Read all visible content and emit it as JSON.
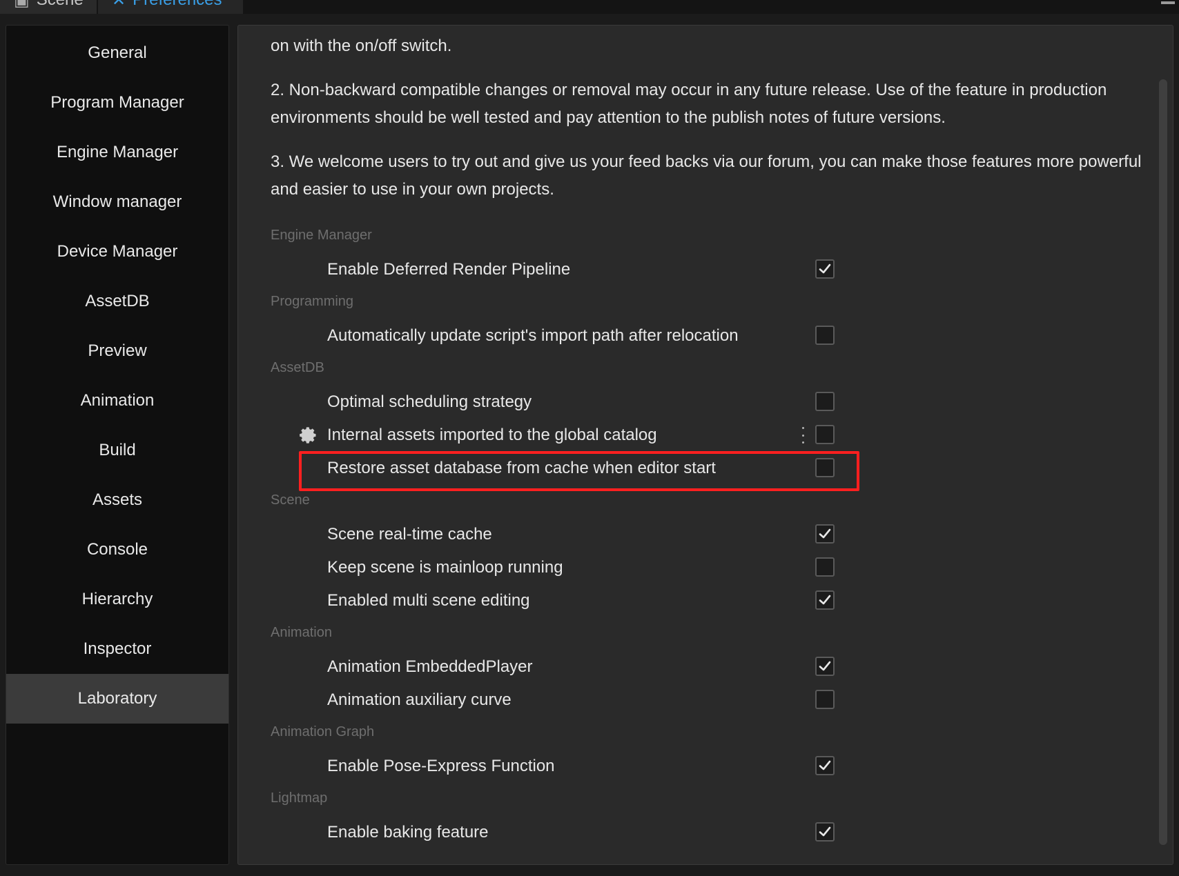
{
  "tabs": {
    "scene": "Scene",
    "preferences": "Preferences"
  },
  "sidebar": {
    "items": [
      {
        "label": "General"
      },
      {
        "label": "Program Manager"
      },
      {
        "label": "Engine Manager"
      },
      {
        "label": "Window manager"
      },
      {
        "label": "Device Manager"
      },
      {
        "label": "AssetDB"
      },
      {
        "label": "Preview"
      },
      {
        "label": "Animation"
      },
      {
        "label": "Build"
      },
      {
        "label": "Assets"
      },
      {
        "label": "Console"
      },
      {
        "label": "Hierarchy"
      },
      {
        "label": "Inspector"
      },
      {
        "label": "Laboratory"
      }
    ],
    "active": "Laboratory"
  },
  "notes": {
    "p1": "on with the on/off switch.",
    "p2": "2. Non-backward compatible changes or removal may occur in any future release. Use of the feature in production environments should be well tested and pay attention to the publish notes of future versions.",
    "p3": "3. We welcome users to try out and give us your feed backs via our forum, you can make those features more powerful and easier to use in your own projects."
  },
  "sections": {
    "engine_manager": {
      "title": "Engine Manager",
      "deferred": {
        "label": "Enable Deferred Render Pipeline",
        "checked": true
      }
    },
    "programming": {
      "title": "Programming",
      "auto_update": {
        "label": "Automatically update script's import path after relocation",
        "checked": false
      }
    },
    "assetdb": {
      "title": "AssetDB",
      "optimal": {
        "label": "Optimal scheduling strategy",
        "checked": false
      },
      "internal": {
        "label": "Internal assets imported to the global catalog",
        "checked": false
      },
      "restore": {
        "label": "Restore asset database from cache when editor start",
        "checked": false
      }
    },
    "scene": {
      "title": "Scene",
      "realtime": {
        "label": "Scene real-time cache",
        "checked": true
      },
      "mainloop": {
        "label": "Keep scene is mainloop running",
        "checked": false
      },
      "multi": {
        "label": "Enabled multi scene editing",
        "checked": true
      }
    },
    "animation": {
      "title": "Animation",
      "embedded": {
        "label": "Animation EmbeddedPlayer",
        "checked": true
      },
      "auxiliary": {
        "label": "Animation auxiliary curve",
        "checked": false
      }
    },
    "animation_graph": {
      "title": "Animation Graph",
      "pose": {
        "label": "Enable Pose-Express Function",
        "checked": true
      }
    },
    "lightmap": {
      "title": "Lightmap",
      "baking": {
        "label": "Enable baking feature",
        "checked": true
      }
    }
  },
  "colors": {
    "highlight": "#ff1f1f",
    "accent": "#3aa0e8"
  }
}
